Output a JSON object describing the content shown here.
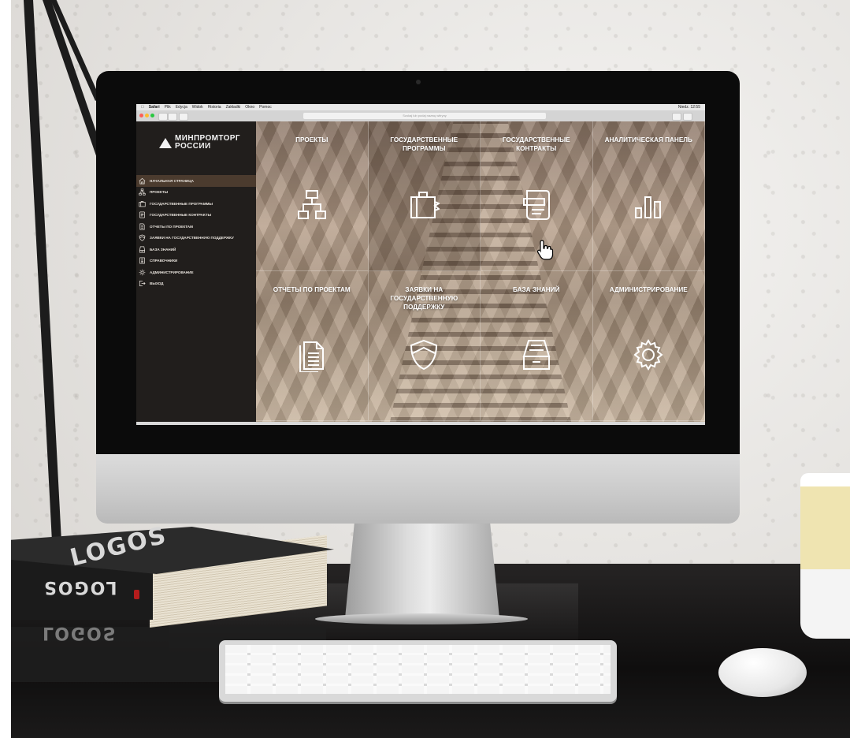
{
  "browser": {
    "menubar": [
      "Safari",
      "Plik",
      "Edycja",
      "Widok",
      "Historia",
      "Zakładki",
      "Okno",
      "Pomoc"
    ],
    "clock": "Niedz. 12:55",
    "url_placeholder": "Szukaj lub podaj nazwę witryny"
  },
  "brand": {
    "line1": "МИНПРОМТОРГ",
    "line2": "РОССИИ"
  },
  "sidebar": {
    "items": [
      {
        "label": "НАЧАЛЬНАЯ СТРАНИЦА",
        "icon": "home-icon",
        "active": true
      },
      {
        "label": "ПРОЕКТЫ",
        "icon": "hierarchy-icon"
      },
      {
        "label": "ГОСУДАРСТВЕННЫЕ ПРОГРАММЫ",
        "icon": "briefcase-icon"
      },
      {
        "label": "ГОСУДАРСТВЕННЫЕ КОНТРАКТЫ",
        "icon": "contract-icon"
      },
      {
        "label": "ОТЧЕТЫ ПО ПРОЕКТАМ",
        "icon": "document-icon"
      },
      {
        "label": "ЗАЯВКИ НА ГОСУДАРСТВЕННУЮ ПОДДЕРЖКУ",
        "icon": "shield-icon"
      },
      {
        "label": "БАЗА ЗНАНИЙ",
        "icon": "archive-icon"
      },
      {
        "label": "СПРАВОЧНИКИ",
        "icon": "book-icon"
      },
      {
        "label": "АДМИНИСТРИРОВАНИЕ",
        "icon": "gear-icon"
      },
      {
        "label": "ВЫХОД",
        "icon": "logout-icon"
      }
    ]
  },
  "tiles": [
    {
      "title": "ПРОЕКТЫ",
      "icon": "hierarchy-icon"
    },
    {
      "title": "ГОСУДАРСТВЕННЫЕ ПРОГРАММЫ",
      "icon": "briefcase-icon",
      "hovered": true
    },
    {
      "title": "ГОСУДАРСТВЕННЫЕ КОНТРАКТЫ",
      "icon": "contract-icon"
    },
    {
      "title": "АНАЛИТИЧЕСКАЯ ПАНЕЛЬ",
      "icon": "bar-chart-icon"
    },
    {
      "title": "ОТЧЕТЫ ПО ПРОЕКТАМ",
      "icon": "document-icon"
    },
    {
      "title": "ЗАЯВКИ НА ГОСУДАРСТВЕННУЮ ПОДДЕРЖКУ",
      "icon": "shield-icon"
    },
    {
      "title": "БАЗА ЗНАНИЙ",
      "icon": "archive-icon"
    },
    {
      "title": "АДМИНИСТРИРОВАНИЕ",
      "icon": "gear-icon"
    }
  ],
  "book": {
    "title": "LOGOS"
  },
  "colors": {
    "sidebar_bg": "#211e1c",
    "active_item": "#4b3b2e",
    "tile_text": "#ffffff"
  }
}
